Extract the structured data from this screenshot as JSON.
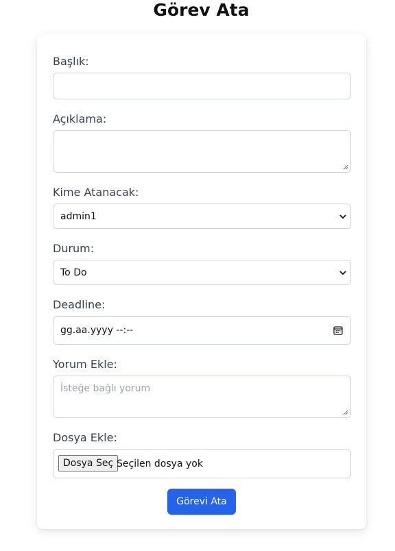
{
  "page": {
    "title": "Görev Ata"
  },
  "form": {
    "title_label": "Başlık:",
    "title_value": "",
    "description_label": "Açıklama:",
    "description_value": "",
    "assignee_label": "Kime Atanacak:",
    "assignee_selected": "admin1",
    "status_label": "Durum:",
    "status_selected": "To Do",
    "deadline_label": "Deadline:",
    "deadline_value": "gg.aa.yyyy --:--",
    "comment_label": "Yorum Ekle:",
    "comment_placeholder": "İsteğe bağlı yorum",
    "file_label": "Dosya Ekle:",
    "file_button_label": "Dosya Seç",
    "file_status": "Seçilen dosya yok",
    "submit_label": "Görevi Ata"
  },
  "icons": {
    "select_chevron": "chevron-down-icon",
    "deadline": "calendar-icon",
    "textarea_grip": "resize-grip-icon"
  },
  "colors": {
    "accent": "#2563eb",
    "label": "#374151",
    "border": "#d1d5db",
    "placeholder": "#9ca3af"
  }
}
